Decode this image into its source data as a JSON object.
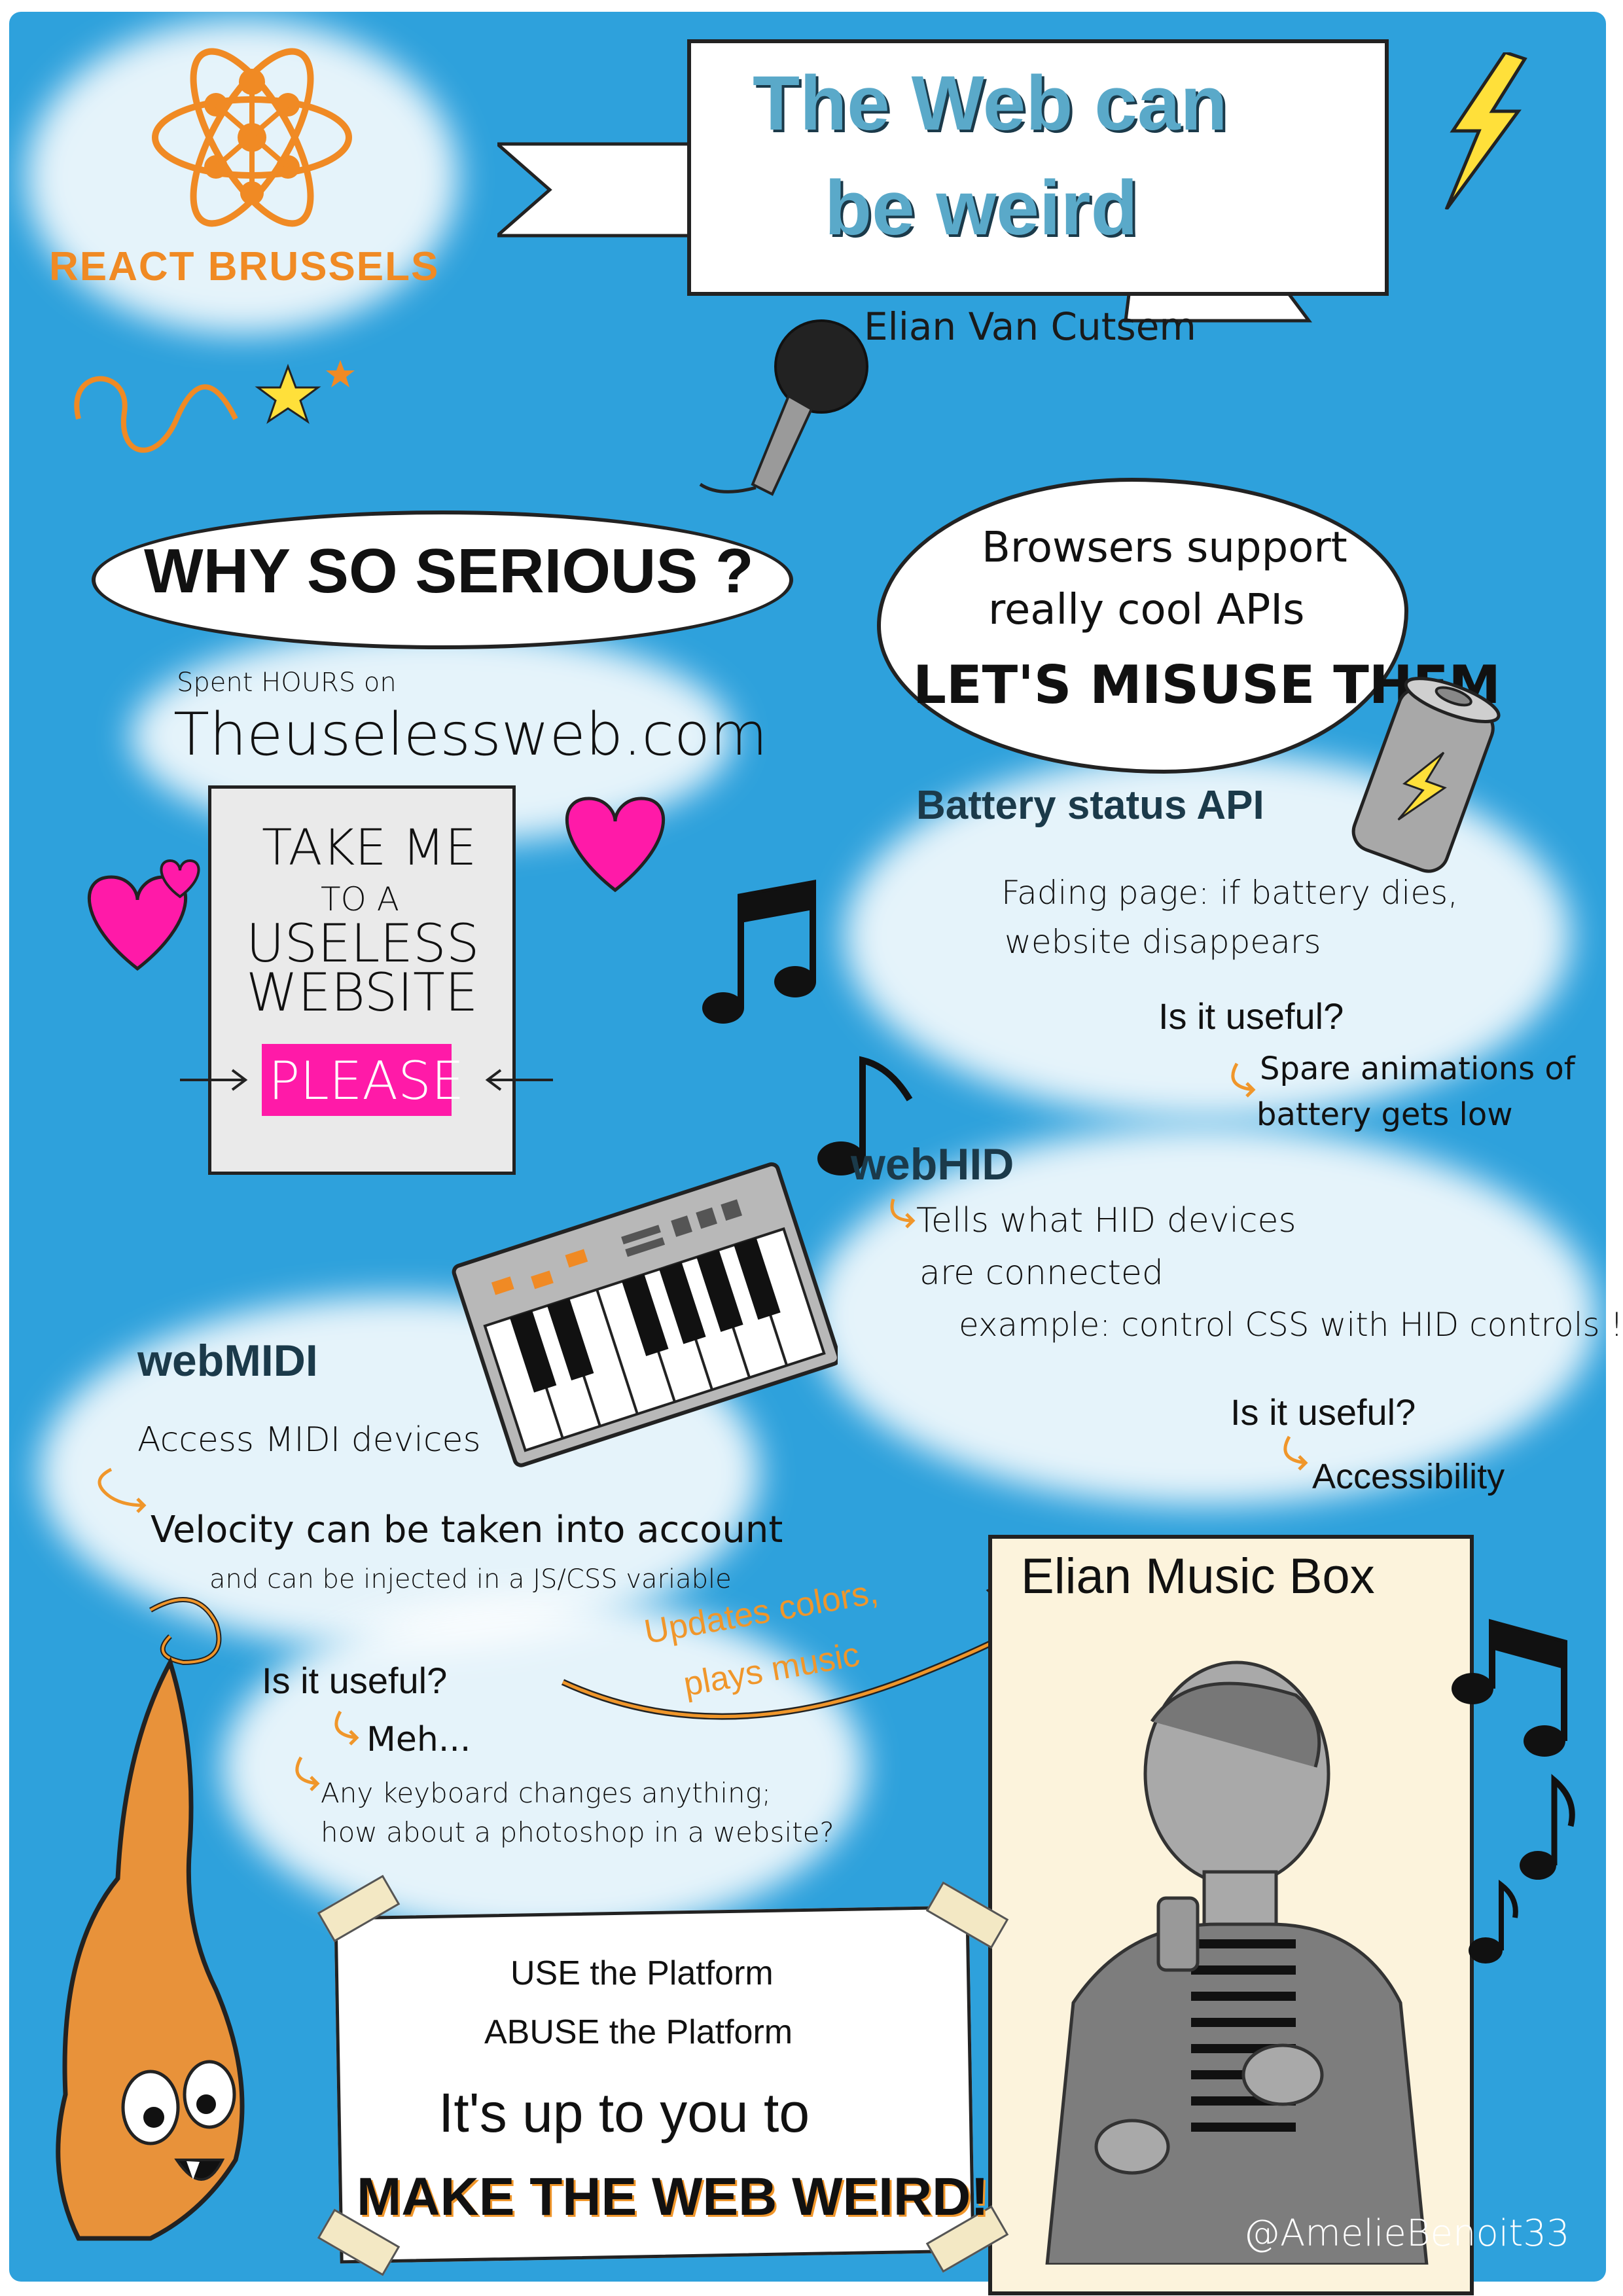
{
  "logo": {
    "text": "REACT BRUSSELS",
    "color": "#f08a24"
  },
  "title": {
    "line1": "The Web can",
    "line2": "be weird",
    "speaker": "Elian Van Cutsem"
  },
  "intro": {
    "headline": "WHY SO SERIOUS ?",
    "spent": "Spent HOURS on",
    "site": "Theuselessweb.com",
    "card_line1": "TAKE ME",
    "card_line2": "TO A",
    "card_line3": "USELESS",
    "card_line4": "WEBSITE",
    "card_button": "PLEASE"
  },
  "browsers": {
    "line1": "Browsers support",
    "line2": "really cool APIs",
    "line3": "LET'S MISUSE THEM"
  },
  "battery": {
    "title": "Battery status API",
    "desc1": "Fading page: if battery dies,",
    "desc2": "website disappears",
    "question": "Is it useful?",
    "answer1": "Spare animations of",
    "answer2": "battery gets low"
  },
  "webhid": {
    "title": "webHID",
    "desc1": "Tells what HID devices",
    "desc2": "are connected",
    "desc3": "example: control CSS with HID controls !",
    "question": "Is it useful?",
    "answer": "Accessibility"
  },
  "webmidi": {
    "title": "webMIDI",
    "desc": "Access MIDI devices",
    "velocity": "Velocity can be taken into account",
    "inject": "and can be injected in a JS/CSS variable",
    "question": "Is it useful?",
    "answer1": "Meh...",
    "answer2": "Any keyboard changes anything;",
    "answer3": "how about a photoshop in a website?"
  },
  "music_box": {
    "title": "Elian Music Box",
    "arrow_label1": "Updates colors,",
    "arrow_label2": "plays music"
  },
  "conclusion": {
    "line1": "USE the Platform",
    "line2": "ABUSE the Platform",
    "line3": "It's up to you to",
    "line4": "MAKE THE WEB WEIRD!"
  },
  "credit": "@AmelieBenoit33",
  "colors": {
    "background": "#2ea1dc",
    "accent_orange": "#f0962a",
    "pink": "#ff1aa8",
    "yellow": "#ffe03a"
  }
}
